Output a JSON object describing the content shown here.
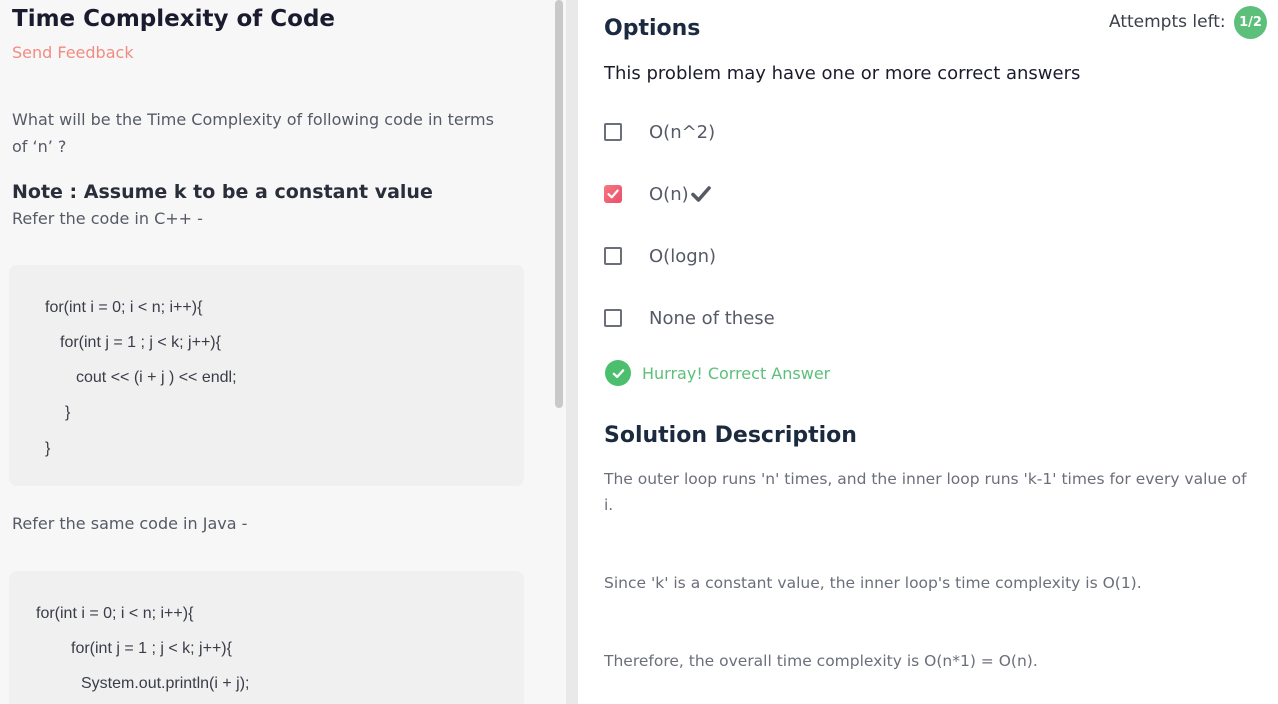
{
  "problem": {
    "title": "Time Complexity of Code",
    "feedback_label": "Send Feedback",
    "question": "What will be the Time Complexity of following code in terms of ‘n’ ?",
    "note": "Note : Assume k to be a constant value",
    "refer_cpp": "Refer the code in C++ -",
    "refer_java": "Refer the same code in Java -",
    "cpp_code": [
      "for(int i = 0; i < n; i++){",
      "for(int j = 1 ; j < k; j++){",
      "cout << (i + j ) << endl;",
      "}",
      "}"
    ],
    "java_code": [
      "for(int i = 0; i < n; i++){",
      "for(int j = 1 ; j < k; j++){",
      "System.out.println(i + j);"
    ]
  },
  "options": {
    "title": "Options",
    "attempts_label": "Attempts left:",
    "attempts_value": "1/2",
    "subtitle": "This problem may have one or more correct answers",
    "items": [
      {
        "label": "O(n^2)",
        "checked": false
      },
      {
        "label": "O(n)",
        "checked": true,
        "correct_mark": "check-icon"
      },
      {
        "label": "O(logn)",
        "checked": false
      },
      {
        "label": "None of these",
        "checked": false
      }
    ],
    "result": "Hurray! Correct Answer",
    "colors": {
      "accent_green": "#5cbf7a",
      "checkbox_checked": "#e94e6b",
      "feedback": "#f28b82"
    }
  },
  "solution": {
    "title": "Solution Description",
    "paragraphs": [
      " The outer loop runs 'n' times, and the inner loop runs 'k-1' times for every value of i.",
      "Since 'k' is a constant value, the inner loop's time complexity is O(1).",
      "Therefore, the overall time complexity is O(n*1) = O(n)."
    ]
  }
}
